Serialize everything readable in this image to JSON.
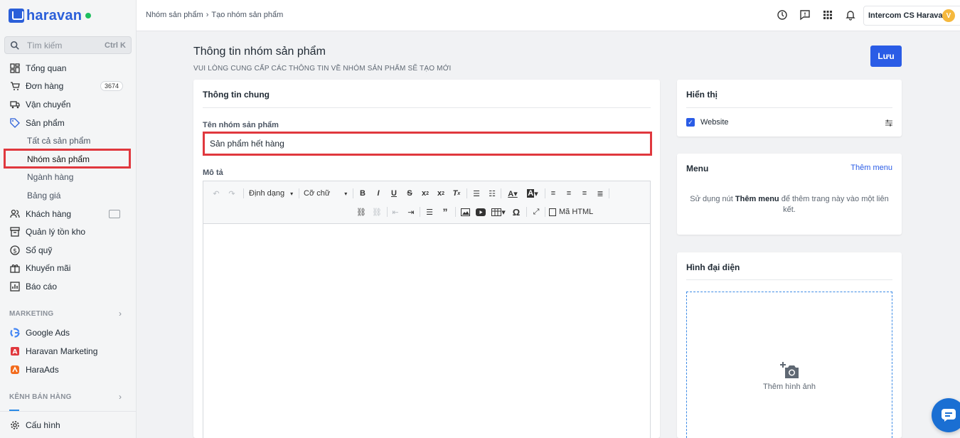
{
  "brand": {
    "name": "haravan",
    "accent": "#2b5fd9",
    "status_color": "#1fbf5f"
  },
  "search": {
    "placeholder": "Tìm kiếm",
    "shortcut": "Ctrl K"
  },
  "sidebar": {
    "items": [
      {
        "label": "Tổng quan",
        "icon": "dashboard-icon"
      },
      {
        "label": "Đơn hàng",
        "icon": "cart-icon",
        "badge": "3674"
      },
      {
        "label": "Vận chuyển",
        "icon": "truck-icon"
      },
      {
        "label": "Sản phẩm",
        "icon": "tag-icon"
      },
      {
        "label": "Khách hàng",
        "icon": "users-icon"
      },
      {
        "label": "Quản lý tồn kho",
        "icon": "inventory-icon"
      },
      {
        "label": "Sổ quỹ",
        "icon": "dollar-icon"
      },
      {
        "label": "Khuyến mãi",
        "icon": "gift-icon"
      },
      {
        "label": "Báo cáo",
        "icon": "report-icon"
      }
    ],
    "product_sub": [
      "Tất cả sản phẩm",
      "Nhóm sản phẩm",
      "Ngành hàng",
      "Bảng giá"
    ],
    "marketing_label": "MARKETING",
    "marketing_items": [
      "Google Ads",
      "Haravan Marketing",
      "HaraAds"
    ],
    "sales_channel_label": "KÊNH BÁN HÀNG",
    "settings_label": "Cấu hình"
  },
  "topbar": {
    "breadcrumb": [
      "Nhóm sản phẩm",
      "›",
      "Tạo nhóm sản phẩm"
    ],
    "user_name": "Intercom CS Haravan",
    "avatar_letter": "V"
  },
  "page": {
    "title": "Thông tin nhóm sản phẩm",
    "subtitle": "VUI LÒNG CUNG CẤP CÁC THÔNG TIN VỀ NHÓM SẢN PHẨM SẼ TẠO MỚI",
    "save_label": "Lưu"
  },
  "general": {
    "title": "Thông tin chung",
    "name_label": "Tên nhóm sản phẩm",
    "name_value": "Sản phẩm hết hàng",
    "desc_label": "Mô tả",
    "toolbar": {
      "format": "Định dạng",
      "font_size": "Cỡ chữ",
      "html": "Mã HTML"
    }
  },
  "display": {
    "title": "Hiển thị",
    "website_label": "Website",
    "website_checked": true
  },
  "menu": {
    "title": "Menu",
    "add_link": "Thêm menu",
    "desc_pre": "Sử dụng nút ",
    "desc_bold": "Thêm menu",
    "desc_post": " để thêm trang này vào một liên kết."
  },
  "image": {
    "title": "Hình đại diện",
    "add_label": "Thêm hình ảnh"
  }
}
